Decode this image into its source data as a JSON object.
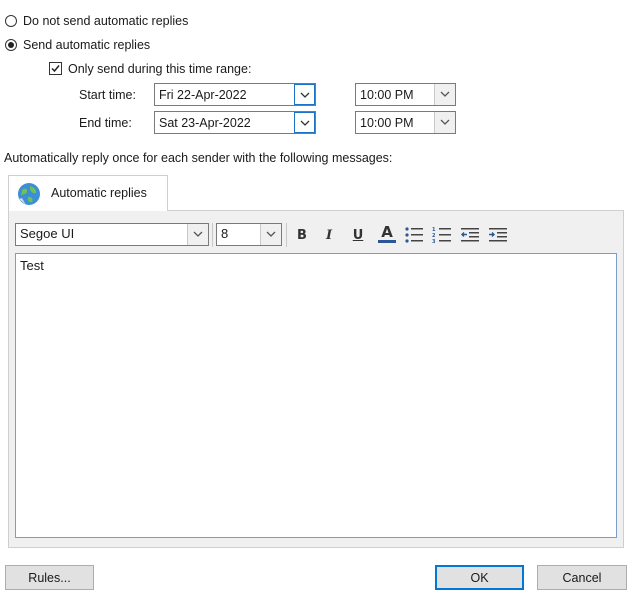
{
  "reply_mode": {
    "no_replies_label": "Do not send automatic replies",
    "send_replies_label": "Send automatic replies",
    "selected": "send"
  },
  "time_range": {
    "checkbox_label": "Only send during this time range:",
    "checked": true,
    "start_label": "Start time:",
    "start_date": "Fri 22-Apr-2022",
    "start_time": "10:00 PM",
    "end_label": "End time:",
    "end_date": "Sat 23-Apr-2022",
    "end_time": "10:00 PM"
  },
  "message_intro": "Automatically reply once for each sender with the following messages:",
  "tabs": [
    {
      "label": "Automatic replies",
      "icon": "globe-icon",
      "active": true
    }
  ],
  "toolbar": {
    "font_name": "Segoe UI",
    "font_size": "8",
    "bold": "B",
    "italic": "I",
    "underline": "U",
    "font_color": "A",
    "icons": [
      "bold-icon",
      "italic-icon",
      "underline-icon",
      "font-color-icon",
      "bullets-icon",
      "numbering-icon",
      "decrease-indent-icon",
      "increase-indent-icon"
    ]
  },
  "editor": {
    "content": "Test"
  },
  "buttons": {
    "rules": "Rules...",
    "ok": "OK",
    "cancel": "Cancel"
  },
  "colors": {
    "accent": "#0078d7",
    "font_color_bar": "#2b5797",
    "panel_bg": "#f0f0f0"
  }
}
